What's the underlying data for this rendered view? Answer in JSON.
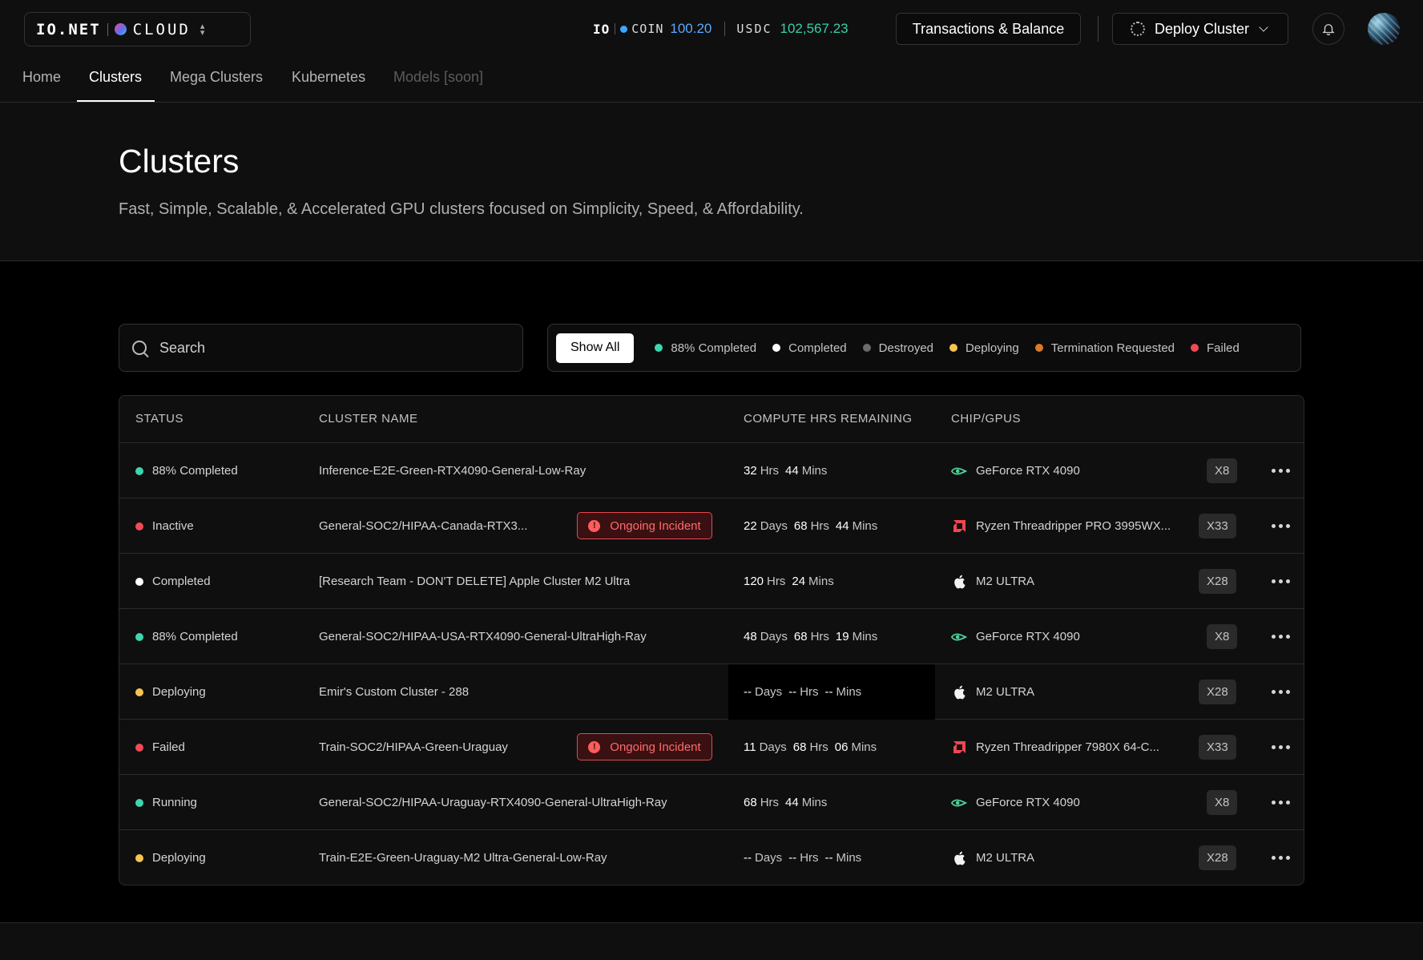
{
  "header": {
    "brand": "IO.NET",
    "product": "CLOUD",
    "io_mark": "IO",
    "coin_label": "COIN",
    "coin_value": "100.20",
    "usdc_label": "USDC",
    "usdc_value": "102,567.23",
    "transactions_button": "Transactions & Balance",
    "deploy_button": "Deploy Cluster"
  },
  "nav": {
    "items": [
      "Home",
      "Clusters",
      "Mega Clusters",
      "Kubernetes",
      "Models [soon]"
    ],
    "active": "Clusters"
  },
  "hero": {
    "title": "Clusters",
    "subtitle": "Fast, Simple, Scalable, & Accelerated GPU clusters focused on Simplicity, Speed, & Affordability."
  },
  "search": {
    "placeholder": "Search"
  },
  "filters": {
    "show_all": "Show All",
    "chips": [
      {
        "label": "88% Completed",
        "color": "#3ed6b0"
      },
      {
        "label": "Completed",
        "color": "#ffffff"
      },
      {
        "label": "Destroyed",
        "color": "#6b6b6b"
      },
      {
        "label": "Deploying",
        "color": "#f5c451"
      },
      {
        "label": "Termination Requested",
        "color": "#d97a2b"
      },
      {
        "label": "Failed",
        "color": "#ef4b55"
      }
    ]
  },
  "table": {
    "headers": [
      "STATUS",
      "CLUSTER NAME",
      "COMPUTE HRS REMAINING",
      "CHIP/GPUS"
    ],
    "incident_label": "Ongoing Incident",
    "rows": [
      {
        "status": "88% Completed",
        "status_color": "#3ed6b0",
        "name": "Inference-E2E-Green-RTX4090-General-Low-Ray",
        "incident": false,
        "compute": [
          [
            "32",
            "Hrs"
          ],
          [
            "44",
            "Mins"
          ]
        ],
        "chip": "GeForce RTX 4090",
        "chip_icon": "nvidia-icon",
        "gpus": "X8"
      },
      {
        "status": "Inactive",
        "status_color": "#ef4b55",
        "name": "General-SOC2/HIPAA-Canada-RTX3...",
        "incident": true,
        "compute": [
          [
            "22",
            "Days"
          ],
          [
            "68",
            "Hrs"
          ],
          [
            "44",
            "Mins"
          ]
        ],
        "chip": "Ryzen Threadripper PRO 3995WX...",
        "chip_icon": "amd-icon",
        "gpus": "X33"
      },
      {
        "status": "Completed",
        "status_color": "#ffffff",
        "name": "[Research Team - DON'T DELETE] Apple Cluster M2 Ultra",
        "incident": false,
        "compute": [
          [
            "120",
            "Hrs"
          ],
          [
            "24",
            "Mins"
          ]
        ],
        "chip": "M2 ULTRA",
        "chip_icon": "apple-icon",
        "gpus": "X28"
      },
      {
        "status": "88% Completed",
        "status_color": "#3ed6b0",
        "name": "General-SOC2/HIPAA-USA-RTX4090-General-UltraHigh-Ray",
        "incident": false,
        "compute": [
          [
            "48",
            "Days"
          ],
          [
            "68",
            "Hrs"
          ],
          [
            "19",
            "Mins"
          ]
        ],
        "chip": "GeForce RTX 4090",
        "chip_icon": "nvidia-icon",
        "gpus": "X8"
      },
      {
        "status": "Deploying",
        "status_color": "#f5c451",
        "name": "Emir's Custom Cluster - 288",
        "incident": false,
        "compute": [
          [
            "--",
            "Days"
          ],
          [
            "--",
            "Hrs"
          ],
          [
            "--",
            "Mins"
          ]
        ],
        "chip": "M2 ULTRA",
        "chip_icon": "apple-icon",
        "gpus": "X28"
      },
      {
        "status": "Failed",
        "status_color": "#ef4b55",
        "name": "Train-SOC2/HIPAA-Green-Uraguay",
        "incident": true,
        "compute": [
          [
            "11",
            "Days"
          ],
          [
            "68",
            "Hrs"
          ],
          [
            "06",
            "Mins"
          ]
        ],
        "chip": "Ryzen Threadripper 7980X 64-C...",
        "chip_icon": "amd-icon",
        "gpus": "X33"
      },
      {
        "status": "Running",
        "status_color": "#3ed6b0",
        "name": "General-SOC2/HIPAA-Uraguay-RTX4090-General-UltraHigh-Ray",
        "incident": false,
        "compute": [
          [
            "68",
            "Hrs"
          ],
          [
            "44",
            "Mins"
          ]
        ],
        "chip": "GeForce RTX 4090",
        "chip_icon": "nvidia-icon",
        "gpus": "X8"
      },
      {
        "status": "Deploying",
        "status_color": "#f5c451",
        "name": "Train-E2E-Green-Uraguay-M2 Ultra-General-Low-Ray",
        "incident": false,
        "compute": [
          [
            "--",
            "Days"
          ],
          [
            "--",
            "Hrs"
          ],
          [
            "--",
            "Mins"
          ]
        ],
        "chip": "M2 ULTRA",
        "chip_icon": "apple-icon",
        "gpus": "X28"
      }
    ]
  }
}
